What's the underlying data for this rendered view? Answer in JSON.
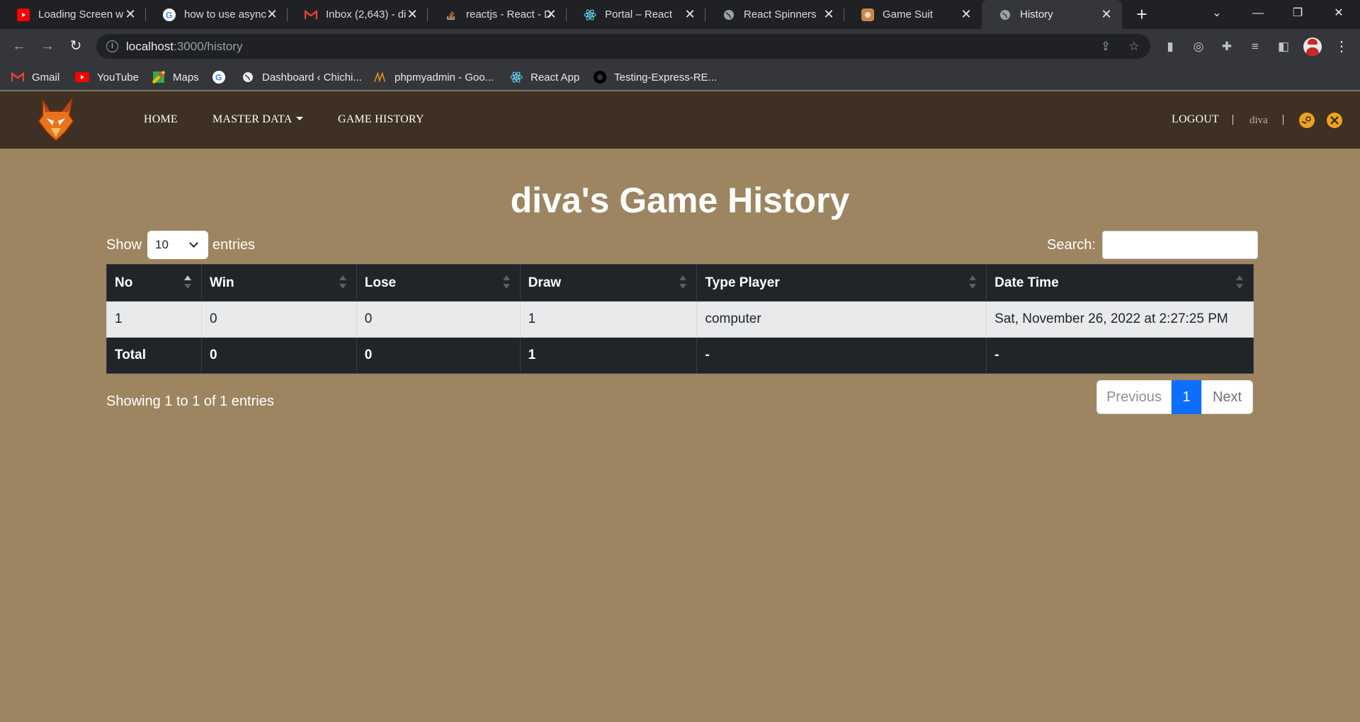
{
  "browser": {
    "tabs": [
      {
        "title": "Loading Screen w",
        "icon": "youtube-icon",
        "color": "#ff0000"
      },
      {
        "title": "how to use async",
        "icon": "google-icon",
        "color": "#ffffff"
      },
      {
        "title": "Inbox (2,643) - di",
        "icon": "gmail-icon",
        "color": "#ea4335"
      },
      {
        "title": "reactjs - React - D",
        "icon": "stackoverflow-icon",
        "color": "#f48024"
      },
      {
        "title": "Portal – React",
        "icon": "react-icon",
        "color": "#61dafb"
      },
      {
        "title": "React Spinners",
        "icon": "globe-icon",
        "color": "#9aa0a6"
      },
      {
        "title": "Game Suit",
        "icon": "game-icon",
        "color": "#c8864a"
      },
      {
        "title": "History",
        "icon": "globe-icon",
        "color": "#9aa0a6"
      }
    ],
    "url_host": "localhost",
    "url_path": ":3000/history",
    "bookmarks": [
      {
        "label": "Gmail",
        "icon": "gmail-icon"
      },
      {
        "label": "YouTube",
        "icon": "youtube-icon"
      },
      {
        "label": "Maps",
        "icon": "maps-icon"
      },
      {
        "label": "",
        "icon": "google-icon"
      },
      {
        "label": "Dashboard ‹ Chichi...",
        "icon": "globe-icon"
      },
      {
        "label": "phpmyadmin - Goo...",
        "icon": "phpmyadmin-icon"
      },
      {
        "label": "React App",
        "icon": "react-icon"
      },
      {
        "label": "Testing-Express-RE...",
        "icon": "github-icon"
      }
    ]
  },
  "site": {
    "nav": {
      "home": "HOME",
      "master_data": "MASTER DATA",
      "game_history": "GAME HISTORY",
      "logout": "LOGOUT",
      "separator": "|",
      "username": "diva"
    },
    "colors": {
      "navbar": "#3e3022",
      "background": "#9c8560",
      "accent": "#0d6efd"
    }
  },
  "page": {
    "title": "diva's Game History",
    "show_label": "Show",
    "entries_label": "entries",
    "page_size": "10",
    "search_label": "Search:",
    "search_value": "",
    "info": "Showing 1 to 1 of 1 entries"
  },
  "table": {
    "columns": [
      "No",
      "Win",
      "Lose",
      "Draw",
      "Type Player",
      "Date Time"
    ],
    "rows": [
      [
        "1",
        "0",
        "0",
        "1",
        "computer",
        "Sat, November 26, 2022 at 2:27:25 PM"
      ]
    ],
    "footer": [
      "Total",
      "0",
      "0",
      "1",
      "-",
      "-"
    ]
  },
  "pagination": {
    "previous": "Previous",
    "current": "1",
    "next": "Next"
  }
}
